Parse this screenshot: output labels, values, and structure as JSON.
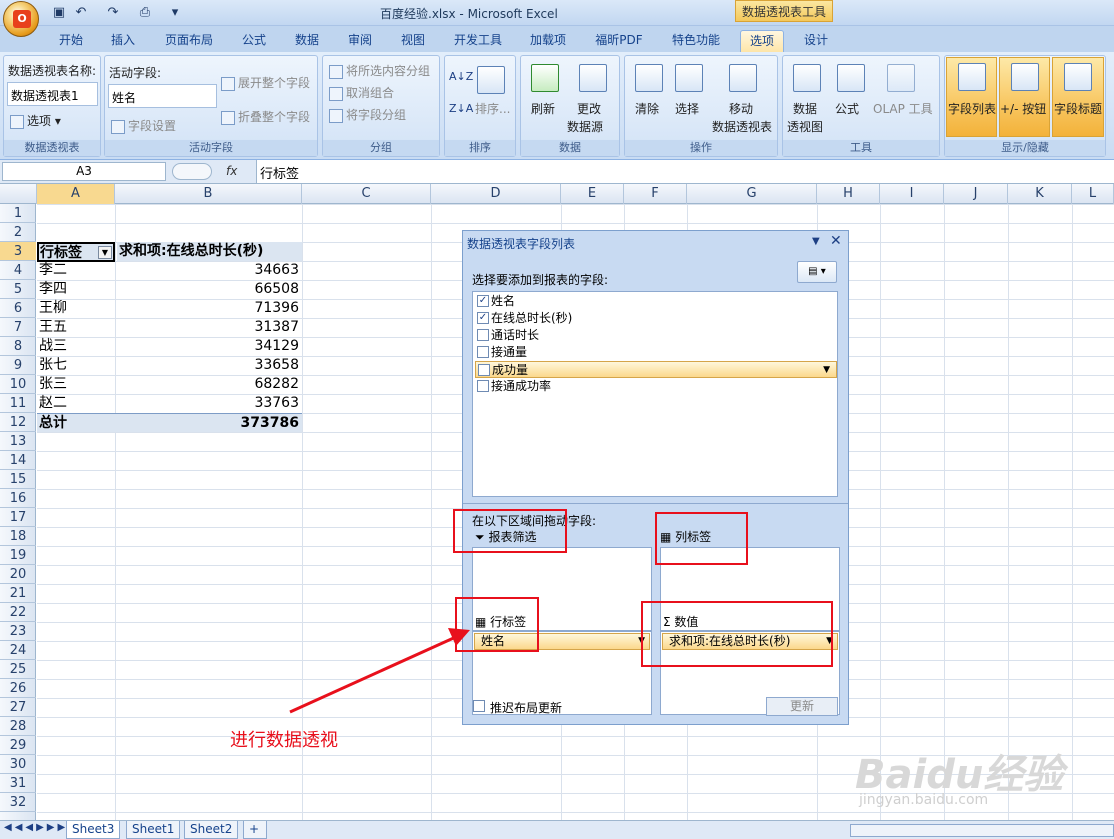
{
  "window": {
    "title": "百度经验.xlsx - Microsoft Excel",
    "context_tab_title": "数据透视表工具"
  },
  "tabs": [
    "开始",
    "插入",
    "页面布局",
    "公式",
    "数据",
    "审阅",
    "视图",
    "开发工具",
    "加载项",
    "福昕PDF",
    "特色功能",
    "选项",
    "设计"
  ],
  "active_tab": "选项",
  "ribbon": {
    "pivot_group": {
      "name_label": "数据透视表名称:",
      "name_value": "数据透视表1",
      "options_label": "选项",
      "title": "数据透视表"
    },
    "active_field_group": {
      "label": "活动字段:",
      "value": "姓名",
      "field_settings": "字段设置",
      "expand": "展开整个字段",
      "collapse": "折叠整个字段",
      "title": "活动字段"
    },
    "group_group": {
      "group_selection": "将所选内容分组",
      "ungroup": "取消组合",
      "group_field": "将字段分组",
      "title": "分组"
    },
    "sort_group": {
      "sort": "排序...",
      "title": "排序"
    },
    "data_group": {
      "refresh": "刷新",
      "change_source_1": "更改",
      "change_source_2": "数据源",
      "title": "数据"
    },
    "actions_group": {
      "clear": "清除",
      "select": "选择",
      "move_1": "移动",
      "move_2": "数据透视表",
      "title": "操作"
    },
    "tools_group": {
      "pivotchart_1": "数据",
      "pivotchart_2": "透视图",
      "formulas": "公式",
      "olap": "OLAP 工具",
      "title": "工具"
    },
    "show_hide_group": {
      "field_list": "字段列表",
      "buttons": "+/- 按钮",
      "headers": "字段标题",
      "title": "显示/隐藏"
    }
  },
  "formula_bar": {
    "name_box": "A3",
    "fx": "fx",
    "value": "行标签"
  },
  "columns": [
    "A",
    "B",
    "C",
    "D",
    "E",
    "F",
    "G",
    "H",
    "I",
    "J",
    "K",
    "L"
  ],
  "rows": [
    "1",
    "2",
    "3",
    "4",
    "5",
    "6",
    "7",
    "8",
    "9",
    "10",
    "11",
    "12",
    "13",
    "14",
    "15",
    "16",
    "17",
    "18",
    "19",
    "20",
    "21",
    "22",
    "23",
    "24",
    "25",
    "26",
    "27",
    "28",
    "29",
    "30",
    "31",
    "32"
  ],
  "pivot": {
    "header_label": "行标签",
    "header_value": "求和项:在线总时长(秒)",
    "items": [
      {
        "name": "李二",
        "value": "34663"
      },
      {
        "name": "李四",
        "value": "66508"
      },
      {
        "name": "王柳",
        "value": "71396"
      },
      {
        "name": "王五",
        "value": "31387"
      },
      {
        "name": "战三",
        "value": "34129"
      },
      {
        "name": "张七",
        "value": "33658"
      },
      {
        "name": "张三",
        "value": "68282"
      },
      {
        "name": "赵二",
        "value": "33763"
      }
    ],
    "total_label": "总计",
    "total_value": "373786"
  },
  "field_pane": {
    "title": "数据透视表字段列表",
    "choose_label": "选择要添加到报表的字段:",
    "fields": [
      {
        "name": "姓名",
        "checked": "✓"
      },
      {
        "name": "在线总时长(秒)",
        "checked": "✓"
      },
      {
        "name": "通话时长",
        "checked": ""
      },
      {
        "name": "接通量",
        "checked": ""
      },
      {
        "name": "成功量",
        "checked": ""
      },
      {
        "name": "接通成功率",
        "checked": ""
      }
    ],
    "drag_label": "在以下区域间拖动字段:",
    "filter_label": "报表筛选",
    "column_label": "列标签",
    "row_label": "行标签",
    "values_label": "数值",
    "row_chip": "姓名",
    "value_chip": "求和项:在线总时长(秒)",
    "defer_label": "推迟布局更新",
    "update_button": "更新"
  },
  "annotation": {
    "text": "进行数据透视",
    "color": "#e8101c"
  },
  "sheets": [
    "Sheet3",
    "Sheet1",
    "Sheet2"
  ],
  "watermark": {
    "line1": "Baidu经验",
    "line2": "jingyan.baidu.com"
  }
}
